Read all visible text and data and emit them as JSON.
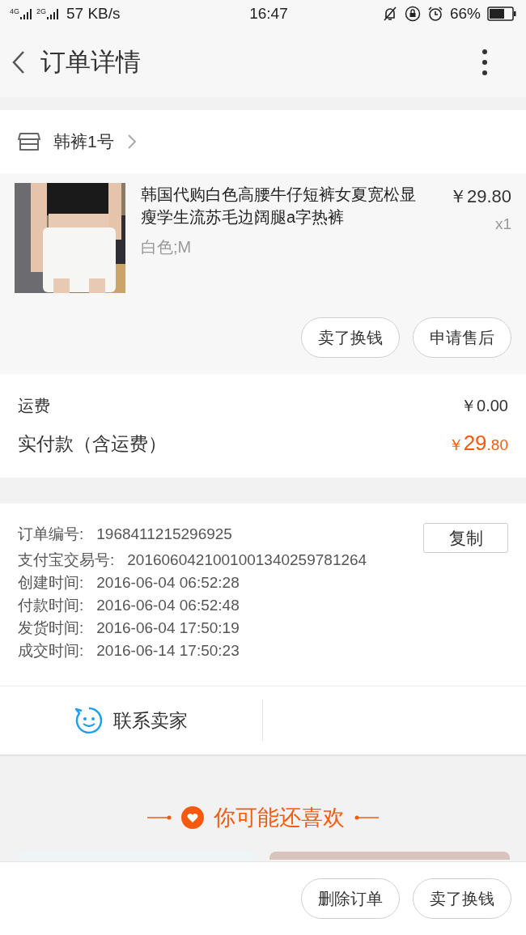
{
  "status_bar": {
    "network_1": "4G",
    "network_2": "2G",
    "speed": "57 KB/s",
    "time": "16:47",
    "battery": "66%"
  },
  "header": {
    "title": "订单详情"
  },
  "shop": {
    "name": "韩裤1号"
  },
  "product": {
    "title": "韩国代购白色高腰牛仔短裤女夏宽松显瘦学生流苏毛边阔腿a字热裤",
    "variant": "白色;M",
    "price": "￥29.80",
    "quantity": "x1",
    "actions": [
      "卖了换钱",
      "申请售后"
    ]
  },
  "fees": {
    "shipping_label": "运费",
    "shipping_value": "￥0.00",
    "paid_label": "实付款（含运费）",
    "paid_currency": "￥",
    "paid_integer": "29",
    "paid_decimal": ".80"
  },
  "order_info": {
    "rows": [
      {
        "label": "订单编号:",
        "value": "1968411215296925"
      },
      {
        "label": "支付宝交易号:",
        "value": "2016060421001001340259781264"
      },
      {
        "label": "创建时间:",
        "value": "2016-06-04 06:52:28"
      },
      {
        "label": "付款时间:",
        "value": "2016-06-04 06:52:48"
      },
      {
        "label": "发货时间:",
        "value": "2016-06-04 17:50:19"
      },
      {
        "label": "成交时间:",
        "value": "2016-06-14 17:50:23"
      }
    ],
    "copy_button": "复制"
  },
  "contact": {
    "label": "联系卖家"
  },
  "recommend": {
    "title": "你可能还喜欢"
  },
  "bottom_bar": {
    "buttons": [
      "删除订单",
      "卖了换钱"
    ]
  }
}
